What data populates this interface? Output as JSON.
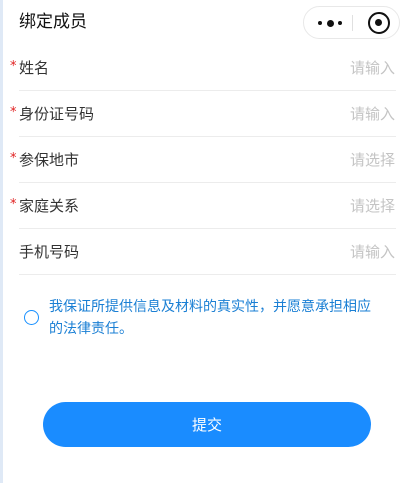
{
  "nav": {
    "title": "绑定成员",
    "more_icon": "more-dots-icon",
    "close_icon": "capsule-close-icon"
  },
  "form": {
    "required_mark": "*",
    "rows": [
      {
        "label": "姓名",
        "placeholder": "请输入",
        "required": true
      },
      {
        "label": "身份证号码",
        "placeholder": "请输入",
        "required": true
      },
      {
        "label": "参保地市",
        "placeholder": "请选择",
        "required": true
      },
      {
        "label": "家庭关系",
        "placeholder": "请选择",
        "required": true
      },
      {
        "label": "手机号码",
        "placeholder": "请输入",
        "required": false
      }
    ]
  },
  "agreement": {
    "text": "我保证所提供信息及材料的真实性，并愿意承担相应的法律责任。",
    "checked": false
  },
  "submit": {
    "label": "提交"
  },
  "colors": {
    "primary": "#1a8cff",
    "required": "#e02020",
    "agreement_text": "#1a7fd4",
    "placeholder": "#c4c4c4"
  }
}
